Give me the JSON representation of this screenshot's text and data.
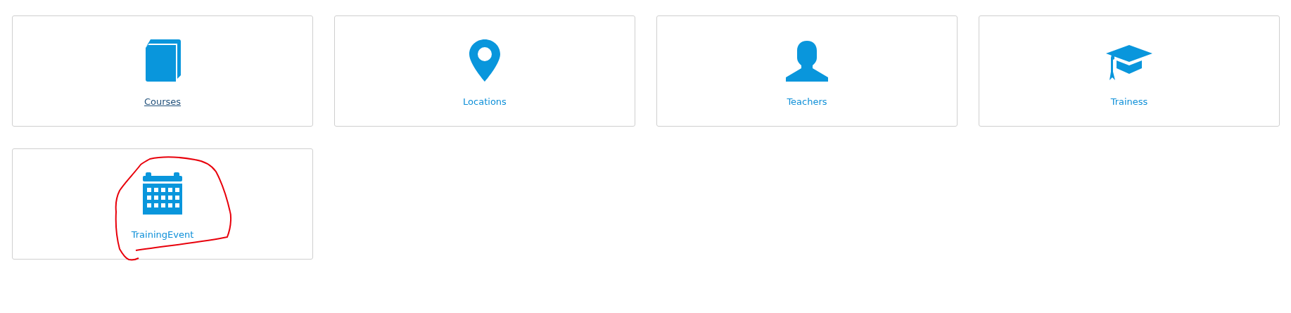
{
  "tiles": [
    {
      "label": "Courses",
      "underlined": true,
      "circled": false
    },
    {
      "label": "Locations",
      "underlined": false,
      "circled": false
    },
    {
      "label": "Teachers",
      "underlined": false,
      "circled": false
    },
    {
      "label": "Trainess",
      "underlined": false,
      "circled": false
    },
    {
      "label": "TrainingEvent",
      "underlined": false,
      "circled": true
    }
  ]
}
